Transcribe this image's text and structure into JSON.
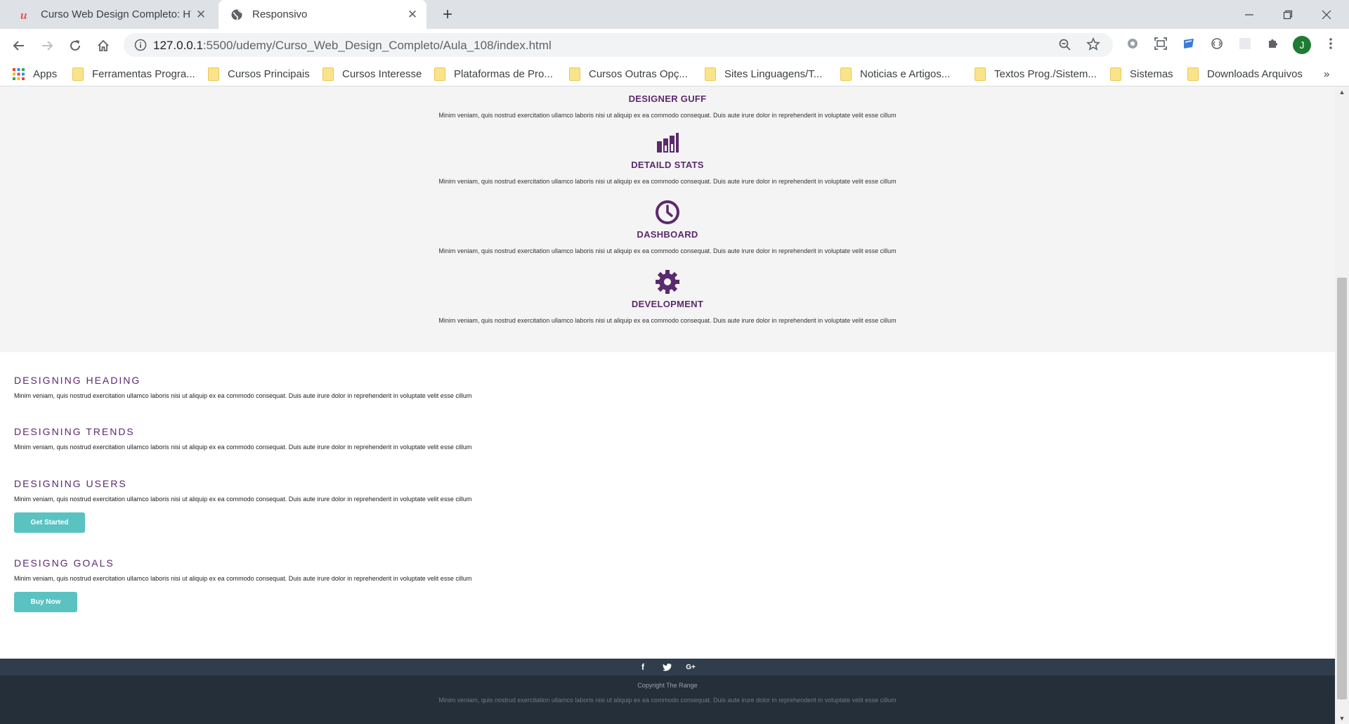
{
  "browser": {
    "tabs": [
      {
        "title": "Curso Web Design Completo: HT",
        "active": false
      },
      {
        "title": "Responsivo",
        "active": true
      }
    ],
    "url_host": "127.0.0.1",
    "url_path": ":5500/udemy/Curso_Web_Design_Completo/Aula_108/index.html",
    "profile_initial": "J",
    "bookmarks": [
      "Apps",
      "Ferramentas Progra...",
      "Cursos Principais",
      "Cursos Interesse",
      "Plataformas de Pro...",
      "Cursos Outras Opç...",
      "Sites Linguagens/T...",
      "Noticias e Artigos...",
      "Textos Prog./Sistem...",
      "Sistemas",
      "Downloads Arquivos"
    ],
    "bookmarks_more": "»"
  },
  "features": [
    {
      "title": "DESIGNER GUFF",
      "icon": "none",
      "text": "Minim veniam, quis nostrud exercitation ullamco laboris nisi ut aliquip ex ea commodo consequat. Duis aute irure dolor in reprehenderit in voluptate velit esse cillum"
    },
    {
      "title": "DETAILD STATS",
      "icon": "bar-chart-icon",
      "text": "Minim veniam, quis nostrud exercitation ullamco laboris nisi ut aliquip ex ea commodo consequat. Duis aute irure dolor in reprehenderit in voluptate velit esse cillum"
    },
    {
      "title": "DASHBOARD",
      "icon": "clock-icon",
      "text": "Minim veniam, quis nostrud exercitation ullamco laboris nisi ut aliquip ex ea commodo consequat. Duis aute irure dolor in reprehenderit in voluptate velit esse cillum"
    },
    {
      "title": "DEVELOPMENT",
      "icon": "gear-icon",
      "text": "Minim veniam, quis nostrud exercitation ullamco laboris nisi ut aliquip ex ea commodo consequat. Duis aute irure dolor in reprehenderit in voluptate velit esse cillum"
    }
  ],
  "sections": [
    {
      "heading": "DESIGNING HEADING",
      "text": "Minim veniam, quis nostrud exercitation ullamco laboris nisi ut aliquip ex ea commodo consequat. Duis aute irure dolor in reprehenderit in voluptate velit esse cillum"
    },
    {
      "heading": "DESIGNING TRENDS",
      "text": "Minim veniam, quis nostrud exercitation ullamco laboris nisi ut aliquip ex ea commodo consequat. Duis aute irure dolor in reprehenderit in voluptate velit esse cillum"
    },
    {
      "heading": "DESIGNING USERS",
      "text": "Minim veniam, quis nostrud exercitation ullamco laboris nisi ut aliquip ex ea commodo consequat. Duis aute irure dolor in reprehenderit in voluptate velit esse cillum",
      "button": "Get Started"
    },
    {
      "heading": "DESIGNG GOALS",
      "text": "Minim veniam, quis nostrud exercitation ullamco laboris nisi ut aliquip ex ea commodo consequat. Duis aute irure dolor in reprehenderit in voluptate velit esse cillum",
      "button": "Buy Now"
    }
  ],
  "footer": {
    "social": [
      "f",
      "t",
      "G+"
    ],
    "copyright": "Copyright The Range",
    "text": "Minim veniam, quis nostrud exercitation ullamco laboris nisi ut aliquip ex ea commodo consequat. Duis aute irure dolor in reprehenderit in voluptate velit esse cillum"
  },
  "colors": {
    "accent": "#5b2a6e",
    "button": "#5bc2c2",
    "footer": "#242f3a",
    "footer_bar": "#2f3d4c"
  }
}
